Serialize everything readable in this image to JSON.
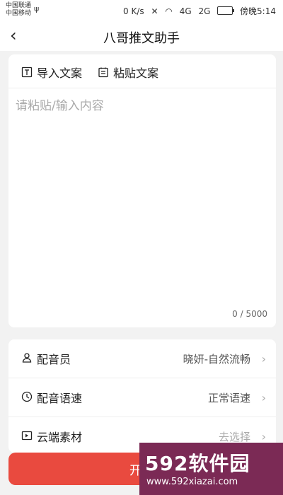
{
  "status_bar": {
    "carrier_1": "中国联通",
    "carrier_2": "中国移动",
    "speed": "0 K/s",
    "network_1": "4G",
    "network_2": "2G",
    "time": "傍晚5:14"
  },
  "nav": {
    "back_icon": "back-arrow",
    "title": "八哥推文助手"
  },
  "toolbar": {
    "import_label": "导入文案",
    "paste_label": "粘贴文案"
  },
  "editor": {
    "placeholder": "请粘贴/输入内容",
    "count": "0 / 5000"
  },
  "settings": [
    {
      "label": "配音员",
      "value": "晓妍-自然流畅",
      "icon": "user-icon"
    },
    {
      "label": "配音语速",
      "value": "正常语速",
      "icon": "clock-icon"
    },
    {
      "label": "云端素材",
      "value": "去选择",
      "icon": "video-icon"
    }
  ],
  "start_button": {
    "label": "开始"
  },
  "watermark": {
    "main": "592软件园",
    "url": "www.592xiazai.com"
  },
  "colors": {
    "accent": "#e94a3f",
    "background": "#f2f2f2",
    "watermark": "#7b2a55"
  }
}
